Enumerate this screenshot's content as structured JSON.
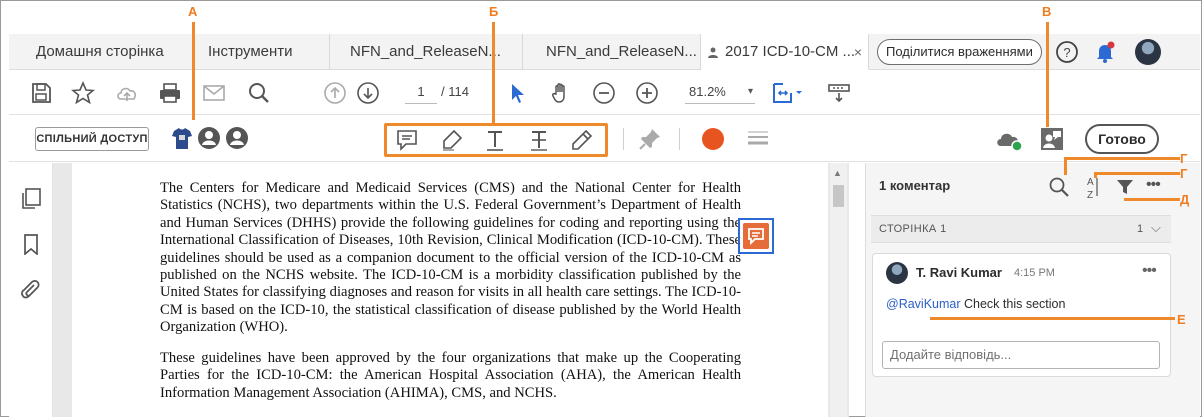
{
  "tabs": [
    {
      "label": "Домашня сторінка"
    },
    {
      "label": "Інструменти"
    },
    {
      "label": "NFN_and_ReleaseN..."
    },
    {
      "label": "NFN_and_ReleaseN..."
    },
    {
      "label": "2017 ICD-10-CM ...",
      "close": "×"
    }
  ],
  "header": {
    "share_feedback": "Поділитися враженнями"
  },
  "toolbar": {
    "page_current": "1",
    "page_total": "/ 114",
    "zoom": "81.2%",
    "zoom_caret": "▾"
  },
  "comment_toolbar": {
    "shared_access": "СПІЛЬНИЙ ДОСТУП",
    "done": "Готово"
  },
  "document": {
    "paragraph1": "The Centers for Medicare and Medicaid Services (CMS) and the National Center for Health Statistics (NCHS), two departments within the U.S. Federal Government’s Department of Health and Human Services (DHHS) provide the following guidelines for coding and reporting using the International Classification of Diseases, 10th Revision, Clinical Modification (ICD-10-CM). These guidelines should be used as a companion document to the official version of the ICD-10-CM as published on the NCHS website. The ICD-10-CM is a morbidity classification published by the United States for classifying diagnoses and reason for visits in all health care settings.  The ICD-10-CM is based on the ICD-10, the statistical classification of disease published by the World Health Organization (WHO).",
    "paragraph2": "These guidelines have been approved by the four organizations that make up the Cooperating Parties for the ICD-10-CM: the American Hospital Association (AHA), the American Health Information Management Association (AHIMA), CMS, and NCHS."
  },
  "comments_pane": {
    "count_label": "1 коментар",
    "page_label": "СТОРІНКА 1",
    "page_count": "1",
    "comment": {
      "author": "T. Ravi Kumar",
      "time": "4:15 PM",
      "mention": "@RaviKumar",
      "text": " Check this section",
      "more": "•••"
    },
    "reply_placeholder": "Додайте відповідь..."
  },
  "callouts": {
    "a": "А",
    "b": "Б",
    "v": "В",
    "g1": "Г",
    "g2": "Г",
    "d": "Д",
    "e": "Е"
  },
  "colors": {
    "accent_orange": "#ef8a2c",
    "mention_blue": "#2b5fc7",
    "color_dot": "#e8541f"
  },
  "icons": [
    "save-icon",
    "star-icon",
    "cloud-upload-icon",
    "print-icon",
    "mail-icon",
    "search-icon",
    "prev-page-icon",
    "next-page-icon",
    "select-icon",
    "hand-icon",
    "zoom-out-icon",
    "zoom-in-icon",
    "fit-page-icon",
    "scroll-icon",
    "sticky-note-icon",
    "highlight-icon",
    "text-icon",
    "strikethrough-icon",
    "pencil-icon",
    "pin-icon",
    "line-style-icon",
    "cloud-status-icon",
    "comment-user-icon",
    "help-icon",
    "bell-icon",
    "thumbnails-icon",
    "bookmark-icon",
    "attachment-icon",
    "sort-icon",
    "filter-icon",
    "more-icon"
  ]
}
